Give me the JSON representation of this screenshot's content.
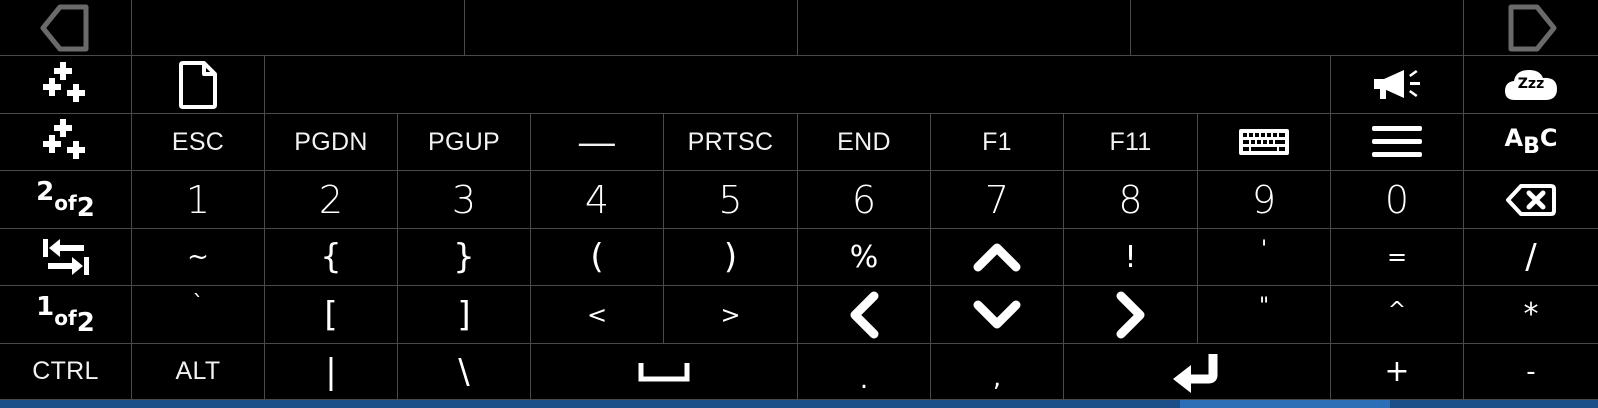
{
  "toolbar": {
    "prev_icon": "left-arrow-outline-icon",
    "next_icon": "right-arrow-outline-icon",
    "suggestions": [
      "",
      "",
      "",
      ""
    ]
  },
  "row1": {
    "add_icon": "add-pluses-icon",
    "file_icon": "new-file-icon",
    "text_field": "",
    "announce_icon": "megaphone-icon",
    "sleep_icon": "sleep-cloud-icon",
    "sleep_label": "Zzz"
  },
  "row2": {
    "add_icon": "add-pluses-icon",
    "keys": [
      "ESC",
      "PGDN",
      "PGUP",
      "—",
      "PRTSC",
      "END",
      "F1",
      "F11"
    ],
    "keyboard_icon": "keyboard-icon",
    "menu_icon": "hamburger-menu-icon",
    "abc": {
      "a": "A",
      "b": "B",
      "c": "C"
    }
  },
  "row3": {
    "page": {
      "num": "2",
      "of": "of",
      "total": "2"
    },
    "digits": [
      "1",
      "2",
      "3",
      "4",
      "5",
      "6",
      "7",
      "8",
      "9",
      "0"
    ],
    "backspace_icon": "backspace-icon"
  },
  "row4": {
    "tab_icon": "tab-arrows-icon",
    "keys": [
      "~",
      "{",
      "}",
      "(",
      ")",
      "%"
    ],
    "up_icon": "chevron-up-icon",
    "keys2": [
      "!",
      "'",
      "=",
      "/"
    ]
  },
  "row5": {
    "page": {
      "num": "1",
      "of": "of",
      "total": "2"
    },
    "keys": [
      "`",
      "[",
      "]",
      "<",
      ">"
    ],
    "left_icon": "chevron-left-icon",
    "down_icon": "chevron-down-icon",
    "right_icon": "chevron-right-icon",
    "keys2": [
      "\"",
      "^",
      "*"
    ]
  },
  "row6": {
    "keys": [
      "CTRL",
      "ALT",
      "|",
      "\\"
    ],
    "space_icon": "space-bar-icon",
    "keys2": [
      ".",
      ","
    ],
    "enter_icon": "enter-return-icon",
    "keys3": [
      "+",
      "-"
    ]
  },
  "colors": {
    "background": "#000000",
    "key_text": "#ffffff",
    "divider": "#4a4a4a",
    "arrow_outline": "#6a6a6a",
    "bottom_accent": "#2d6fb7"
  }
}
